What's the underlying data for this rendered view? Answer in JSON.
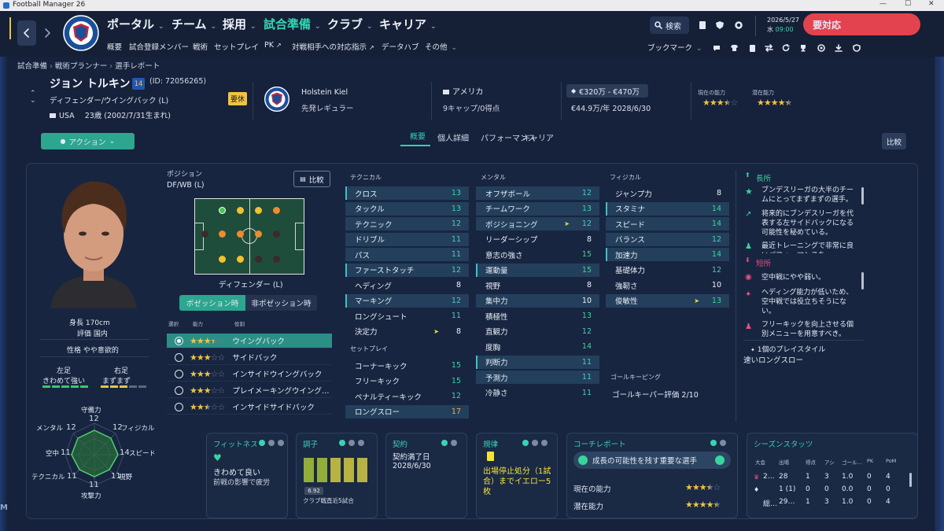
{
  "window": {
    "title": "Football Manager 26"
  },
  "nav": {
    "main": [
      "ポータル",
      "チーム",
      "採用",
      "試合準備",
      "クラブ",
      "キャリア"
    ],
    "sub": [
      "概要",
      "試合登録メンバー",
      "戦術",
      "セットプレイ",
      "PK",
      "対戦相手への対応指示",
      "データハブ",
      "その他"
    ],
    "search": "検索",
    "date": "2026/5/27",
    "weekday": "水",
    "time": "09:00",
    "action_required": "要対応",
    "bookmark": "ブックマーク"
  },
  "breadcrumb": [
    "試合準備",
    "戦術プランナー",
    "選手レポート"
  ],
  "player": {
    "name": "ジョン トルキン",
    "number": "14",
    "id": "(ID: 72056265)",
    "position": "ディフェンダー/ウイングバック (L)",
    "nation": "USA",
    "age": "23歳 (2002/7/31生まれ)",
    "status": "要休",
    "club": "Holstein Kiel",
    "club_role": "先発レギュラー",
    "nationality": "アメリカ",
    "caps": "9キャップ/0得点",
    "value": "€320万 - €470万",
    "wage": "€44.9万/年 2028/6/30",
    "current_ability_label": "現在の能力",
    "potential_label": "潜在能力",
    "current_stars": 3.5,
    "potential_stars": 4.5
  },
  "tabs": [
    "概要",
    "個人詳細",
    "パフォーマンス",
    "キャリア"
  ],
  "buttons": {
    "action": "アクション",
    "compare": "比較",
    "compare2": "比較"
  },
  "profile": {
    "height": "身長 170cm",
    "rating": "評価 国内",
    "personality": "性格 やや意欲的",
    "left_foot_label": "左足",
    "left_foot": "きわめて強い",
    "right_foot_label": "右足",
    "right_foot": "まずまず"
  },
  "position_box": {
    "title": "ポジション",
    "value": "DF/WB (L)",
    "pitch_label": "ディフェンダー (L)",
    "toggle_on": "ポゼッション時",
    "toggle_off": "非ポゼッション時",
    "col_select": "選択",
    "col_ability": "能力",
    "col_role": "役割"
  },
  "roles": [
    {
      "name": "ウイングバック",
      "stars": 3.5
    },
    {
      "name": "サイドバック",
      "stars": 3
    },
    {
      "name": "インサイドウイングバック",
      "stars": 3
    },
    {
      "name": "プレイメーキングウイング…",
      "stars": 3
    },
    {
      "name": "インサイドサイドバック",
      "stars": 2.5
    }
  ],
  "radar": {
    "labels": [
      "守備力",
      "フィジカル",
      "スピード",
      "視野",
      "攻撃力",
      "テクニカル",
      "空中",
      "メンタル"
    ],
    "values": [
      "12",
      "12",
      "14",
      "11",
      "11",
      "11",
      "11",
      "12"
    ]
  },
  "attributes": {
    "technical_title": "テクニカル",
    "technical": [
      [
        "クロス",
        "13"
      ],
      [
        "タックル",
        "13"
      ],
      [
        "テクニック",
        "12"
      ],
      [
        "ドリブル",
        "11"
      ],
      [
        "パス",
        "11"
      ],
      [
        "ファーストタッチ",
        "12"
      ],
      [
        "ヘディング",
        "8"
      ],
      [
        "マーキング",
        "12"
      ],
      [
        "ロングシュート",
        "11"
      ],
      [
        "決定力",
        "8"
      ]
    ],
    "setpiece_title": "セットプレイ",
    "setpiece": [
      [
        "コーナーキック",
        "15"
      ],
      [
        "フリーキック",
        "15"
      ],
      [
        "ペナルティーキック",
        "12"
      ],
      [
        "ロングスロー",
        "17"
      ]
    ],
    "mental_title": "メンタル",
    "mental": [
      [
        "オフザボール",
        "12"
      ],
      [
        "チームワーク",
        "13"
      ],
      [
        "ポジショニング",
        "12"
      ],
      [
        "リーダーシップ",
        "8"
      ],
      [
        "意志の強さ",
        "15"
      ],
      [
        "運動量",
        "15"
      ],
      [
        "視野",
        "8"
      ],
      [
        "集中力",
        "10"
      ],
      [
        "積極性",
        "13"
      ],
      [
        "直観力",
        "12"
      ],
      [
        "度胸",
        "14"
      ],
      [
        "判断力",
        "11"
      ],
      [
        "予測力",
        "11"
      ],
      [
        "冷静さ",
        "11"
      ]
    ],
    "physical_title": "フィジカル",
    "physical": [
      [
        "ジャンプ力",
        "8"
      ],
      [
        "スタミナ",
        "14"
      ],
      [
        "スピード",
        "14"
      ],
      [
        "バランス",
        "12"
      ],
      [
        "加速力",
        "14"
      ],
      [
        "基礎体力",
        "12"
      ],
      [
        "強靭さ",
        "10"
      ],
      [
        "俊敏性",
        "13"
      ]
    ],
    "gk_title": "ゴールキーピング",
    "gk_rating": "ゴールキーパー評価 2/10"
  },
  "strengths": {
    "title": "長所",
    "items": [
      "ブンデスリーガの大半のチームにとってまずまずの選手。",
      "将来的にブンデスリーガを代表する左サイドバックになる可能性を秘めている。",
      "最近トレーニングで非常に良いパフォーマンスを…"
    ]
  },
  "weaknesses": {
    "title": "短所",
    "items": [
      "空中戦にやや弱い。",
      "ヘディング能力が低いため、空中戦では役立ちそうにない。",
      "フリーキックを向上させる個別メニューを用意すべき。"
    ]
  },
  "playstyle": {
    "title": "1個のプレイスタイル",
    "item": "速いロングスロー"
  },
  "cards": {
    "fitness": {
      "title": "フィットネス",
      "status": "きわめて良い",
      "sub": "前戦の影響で疲労"
    },
    "form": {
      "title": "調子",
      "rating": "6.92",
      "sub": "クラブ戦直近5試合",
      "bars": [
        0.9,
        0.9,
        0.9,
        0.9,
        0.9
      ]
    },
    "contract": {
      "title": "契約",
      "label": "契約満了日",
      "value": "2028/6/30"
    },
    "discipline": {
      "title": "規律",
      "text": "出場停止処分（1試合）までイエロー5枚"
    },
    "coach": {
      "title": "コーチレポート",
      "headline": "成長の可能性を残す重要な選手",
      "current": "現在の能力",
      "potential": "潜在能力"
    },
    "season": {
      "title": "シーズンスタッツ",
      "headers": [
        "大会",
        "出場",
        "得点",
        "アシ",
        "ゴール…",
        "PK",
        "PoM"
      ],
      "rows": [
        [
          "2…",
          "28",
          "1",
          "3",
          "1.0",
          "0",
          "4"
        ],
        [
          "",
          "1 (1)",
          "0",
          "0",
          "0.0",
          "0",
          "0"
        ],
        [
          "総…",
          "29…",
          "1",
          "3",
          "1.0",
          "0",
          "4"
        ]
      ]
    }
  },
  "colors": {
    "accent": "#33d6b4",
    "alert": "#e2434e",
    "star": "#f0c344"
  }
}
